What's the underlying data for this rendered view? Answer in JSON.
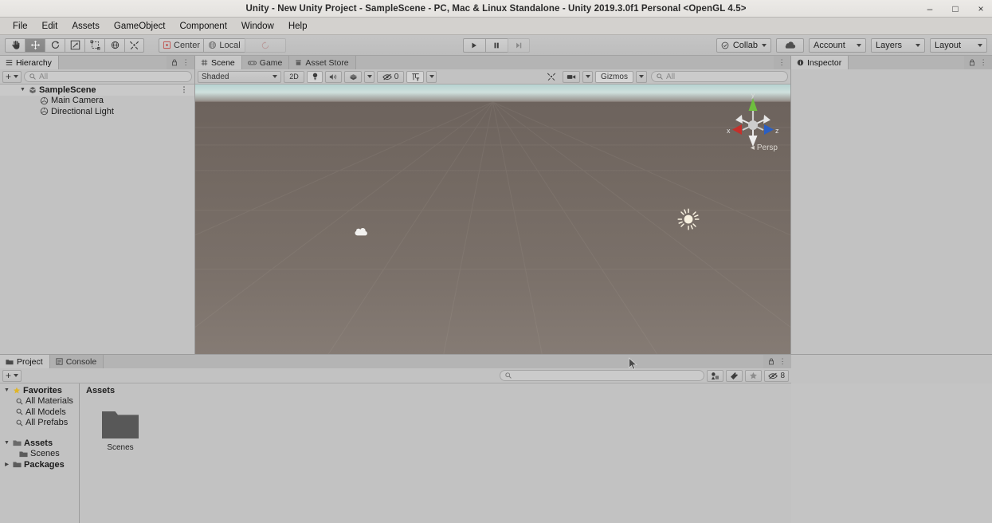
{
  "window": {
    "title": "Unity - New Unity Project - SampleScene - PC, Mac & Linux Standalone - Unity 2019.3.0f1 Personal <OpenGL 4.5>",
    "minimize": "–",
    "maximize": "□",
    "close": "×"
  },
  "menubar": {
    "items": [
      {
        "label": "File"
      },
      {
        "label": "Edit"
      },
      {
        "label": "Assets"
      },
      {
        "label": "GameObject"
      },
      {
        "label": "Component"
      },
      {
        "label": "Window"
      },
      {
        "label": "Help"
      }
    ]
  },
  "toolbar": {
    "tools": [
      {
        "name": "hand-tool",
        "icon": "hand-icon",
        "active": false
      },
      {
        "name": "move-tool",
        "icon": "move-icon",
        "active": true
      },
      {
        "name": "rotate-tool",
        "icon": "rotate-icon",
        "active": false
      },
      {
        "name": "scale-tool",
        "icon": "scale-icon",
        "active": false
      },
      {
        "name": "rect-tool",
        "icon": "rect-icon",
        "active": false
      },
      {
        "name": "transform-tool",
        "icon": "transform-icon",
        "active": false
      },
      {
        "name": "custom-tool",
        "icon": "wrench-icon",
        "active": false
      }
    ],
    "pivot_label": "Center",
    "space_label": "Local",
    "play_label": "▶",
    "pause_label": "‖",
    "step_label": "▶|",
    "collab_label": "Collab",
    "cloud_label": "cloud-icon",
    "account_label": "Account",
    "layers_label": "Layers",
    "layout_label": "Layout"
  },
  "hierarchy": {
    "tab_label": "Hierarchy",
    "add_label": "+",
    "search_placeholder": "All",
    "lock_icon": "lock-icon",
    "menu_icon": "kebab-icon",
    "tree": [
      {
        "label": "SampleScene",
        "depth": 0,
        "twist": "▼",
        "icon": "scene-icon",
        "bold": true,
        "kebab": "⋮"
      },
      {
        "label": "Main Camera",
        "depth": 1,
        "twist": "",
        "icon": "gameobject-icon",
        "bold": false,
        "kebab": ""
      },
      {
        "label": "Directional Light",
        "depth": 1,
        "twist": "",
        "icon": "gameobject-icon",
        "bold": false,
        "kebab": ""
      }
    ]
  },
  "sceneview": {
    "tabs": [
      {
        "label": "Scene",
        "icon": "scene-grid-icon",
        "selected": true
      },
      {
        "label": "Game",
        "icon": "gamepad-icon",
        "selected": false
      },
      {
        "label": "Asset Store",
        "icon": "store-icon",
        "selected": false
      }
    ],
    "menu_icon": "kebab-icon",
    "shading_mode": "Shaded",
    "mode_2d": "2D",
    "lighting_icon": "lightbulb-icon",
    "audio_icon": "speaker-icon",
    "fx_icon": "fx-icon",
    "hidden_count": "0",
    "visibility_icon": "scene-visibility-icon",
    "tools_icon": "wrench-icon",
    "camera_icon": "camera-icon",
    "gizmos_label": "Gizmos",
    "search_placeholder": "All",
    "persp_label": "Persp",
    "axis_x": "x",
    "axis_y": "y",
    "axis_z": "z"
  },
  "inspector": {
    "tab_label": "Inspector",
    "info_icon": "info-icon",
    "lock_icon": "lock-icon",
    "menu_icon": "kebab-icon"
  },
  "project": {
    "tabs": [
      {
        "label": "Project",
        "icon": "folder-icon",
        "selected": true
      },
      {
        "label": "Console",
        "icon": "console-icon",
        "selected": false
      }
    ],
    "lock_icon": "lock-icon",
    "menu_icon": "kebab-icon",
    "create_label": "+",
    "search_placeholder": "",
    "filter_type_icon": "filter-type-icon",
    "filter_label_icon": "filter-label-icon",
    "favorite_icon": "star-icon",
    "visibility_icon": "scene-visibility-icon",
    "visibility_count": "8",
    "tree": [
      {
        "label": "Favorites",
        "depth": 0,
        "twist": "▼",
        "icon": "star-icon",
        "bold": true
      },
      {
        "label": "All Materials",
        "depth": 1,
        "twist": "",
        "icon": "search-icon",
        "bold": false
      },
      {
        "label": "All Models",
        "depth": 1,
        "twist": "",
        "icon": "search-icon",
        "bold": false
      },
      {
        "label": "All Prefabs",
        "depth": 1,
        "twist": "",
        "icon": "search-icon",
        "bold": false
      },
      {
        "label": "",
        "depth": 0,
        "twist": "",
        "icon": "",
        "bold": false
      },
      {
        "label": "Assets",
        "depth": 0,
        "twist": "▼",
        "icon": "folder-icon",
        "bold": true
      },
      {
        "label": "Scenes",
        "depth": 1,
        "twist": "",
        "icon": "folder-icon",
        "bold": false
      },
      {
        "label": "Packages",
        "depth": 0,
        "twist": "▶",
        "icon": "folder-icon",
        "bold": true
      }
    ],
    "breadcrumb": "Assets",
    "assets": [
      {
        "label": "Scenes",
        "icon": "folder-icon"
      }
    ]
  },
  "colors": {
    "chrome": "#c2c2c2",
    "titlebar": "#eceae7",
    "ground": "#7b716a",
    "sky": "#c0dbd8",
    "axis_x": "#c4302b",
    "axis_y": "#5ea82a",
    "axis_z": "#2a5fc4",
    "star": "#e0b528"
  }
}
